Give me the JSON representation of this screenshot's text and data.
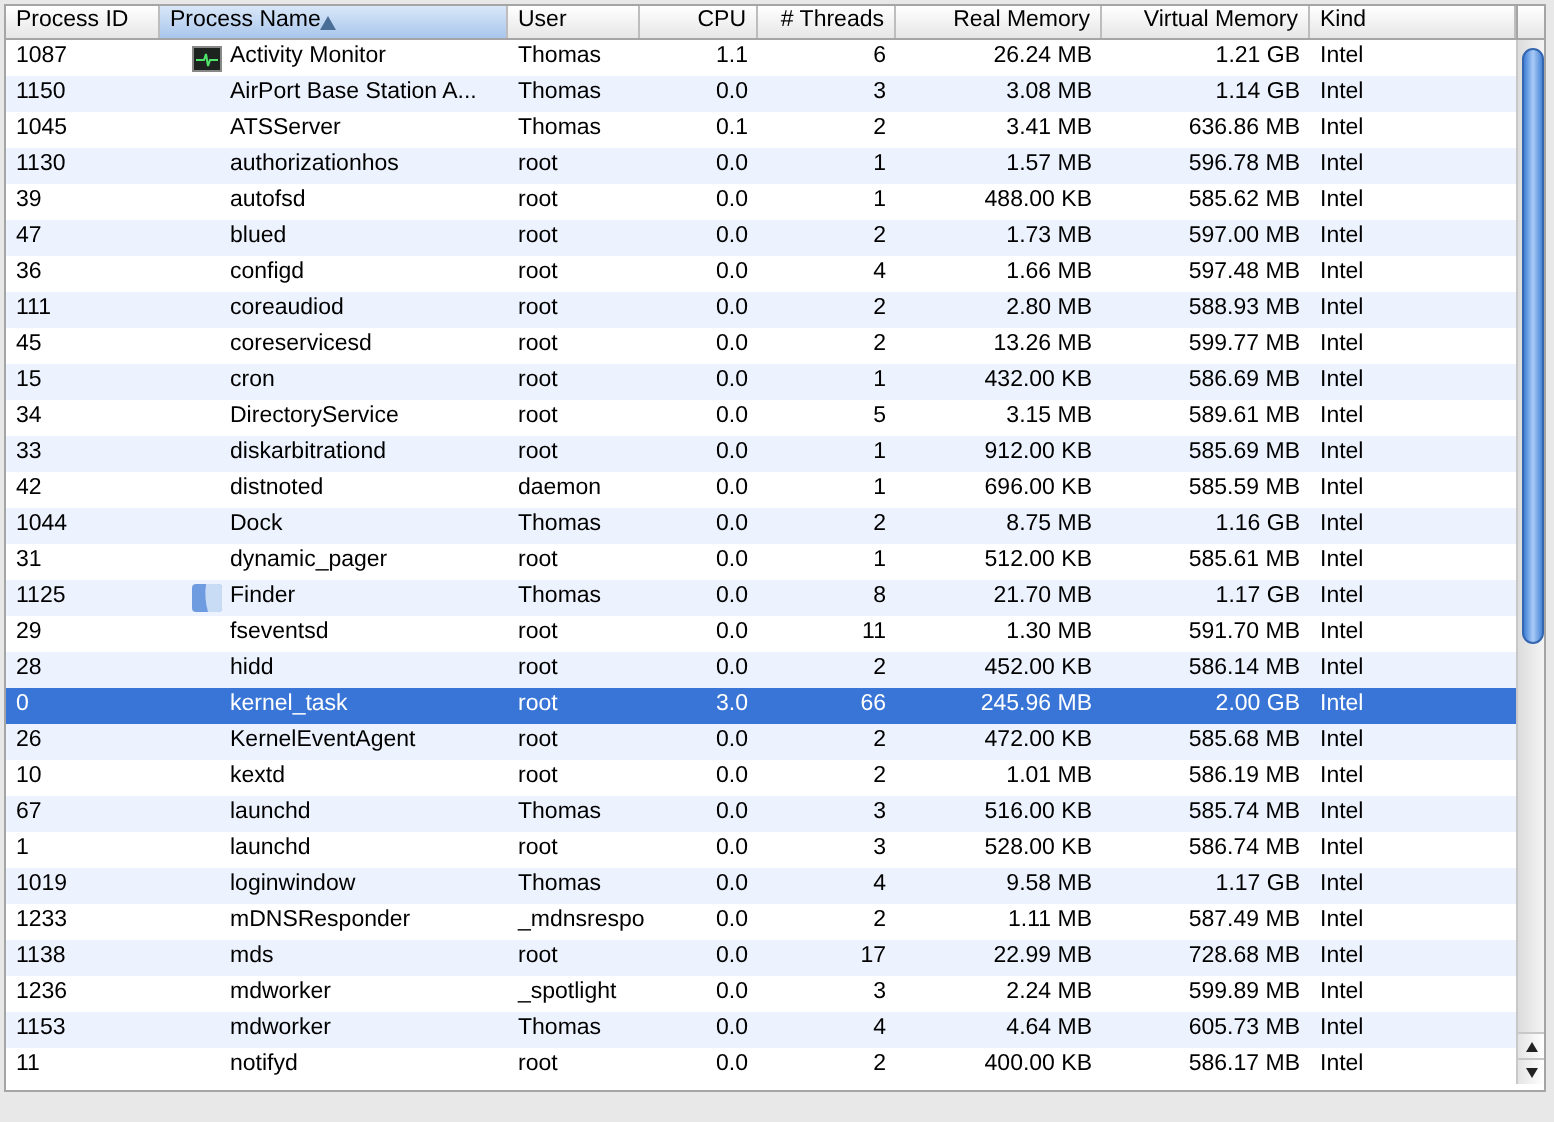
{
  "table": {
    "columns": [
      {
        "label": "Process ID",
        "selected": false
      },
      {
        "label": "Process Name",
        "selected": true
      },
      {
        "label": "User",
        "selected": false
      },
      {
        "label": "CPU",
        "selected": false
      },
      {
        "label": "# Threads",
        "selected": false
      },
      {
        "label": "Real Memory",
        "selected": false
      },
      {
        "label": "Virtual Memory",
        "selected": false
      },
      {
        "label": "Kind",
        "selected": false
      }
    ],
    "rows": [
      {
        "kind": "monitor",
        "selected": false,
        "cells": [
          "1087",
          "Activity Monitor",
          "Thomas",
          "1.1",
          "6",
          "26.24 MB",
          "1.21 GB",
          "Intel"
        ]
      },
      {
        "kind": "plain",
        "selected": false,
        "cells": [
          "1150",
          "AirPort Base Station A...",
          "Thomas",
          "0.0",
          "3",
          "3.08 MB",
          "1.14 GB",
          "Intel"
        ]
      },
      {
        "kind": "plain",
        "selected": false,
        "cells": [
          "1045",
          "ATSServer",
          "Thomas",
          "0.1",
          "2",
          "3.41 MB",
          "636.86 MB",
          "Intel"
        ]
      },
      {
        "kind": "plain",
        "selected": false,
        "cells": [
          "1130",
          "authorizationhos",
          "root",
          "0.0",
          "1",
          "1.57 MB",
          "596.78 MB",
          "Intel"
        ]
      },
      {
        "kind": "plain",
        "selected": false,
        "cells": [
          "39",
          "autofsd",
          "root",
          "0.0",
          "1",
          "488.00 KB",
          "585.62 MB",
          "Intel"
        ]
      },
      {
        "kind": "plain",
        "selected": false,
        "cells": [
          "47",
          "blued",
          "root",
          "0.0",
          "2",
          "1.73 MB",
          "597.00 MB",
          "Intel"
        ]
      },
      {
        "kind": "plain",
        "selected": false,
        "cells": [
          "36",
          "configd",
          "root",
          "0.0",
          "4",
          "1.66 MB",
          "597.48 MB",
          "Intel"
        ]
      },
      {
        "kind": "plain",
        "selected": false,
        "cells": [
          "111",
          "coreaudiod",
          "root",
          "0.0",
          "2",
          "2.80 MB",
          "588.93 MB",
          "Intel"
        ]
      },
      {
        "kind": "plain",
        "selected": false,
        "cells": [
          "45",
          "coreservicesd",
          "root",
          "0.0",
          "2",
          "13.26 MB",
          "599.77 MB",
          "Intel"
        ]
      },
      {
        "kind": "plain",
        "selected": false,
        "cells": [
          "15",
          "cron",
          "root",
          "0.0",
          "1",
          "432.00 KB",
          "586.69 MB",
          "Intel"
        ]
      },
      {
        "kind": "plain",
        "selected": false,
        "cells": [
          "34",
          "DirectoryService",
          "root",
          "0.0",
          "5",
          "3.15 MB",
          "589.61 MB",
          "Intel"
        ]
      },
      {
        "kind": "plain",
        "selected": false,
        "cells": [
          "33",
          "diskarbitrationd",
          "root",
          "0.0",
          "1",
          "912.00 KB",
          "585.69 MB",
          "Intel"
        ]
      },
      {
        "kind": "plain",
        "selected": false,
        "cells": [
          "42",
          "distnoted",
          "daemon",
          "0.0",
          "1",
          "696.00 KB",
          "585.59 MB",
          "Intel"
        ]
      },
      {
        "kind": "plain",
        "selected": false,
        "cells": [
          "1044",
          "Dock",
          "Thomas",
          "0.0",
          "2",
          "8.75 MB",
          "1.16 GB",
          "Intel"
        ]
      },
      {
        "kind": "plain",
        "selected": false,
        "cells": [
          "31",
          "dynamic_pager",
          "root",
          "0.0",
          "1",
          "512.00 KB",
          "585.61 MB",
          "Intel"
        ]
      },
      {
        "kind": "finder",
        "selected": false,
        "cells": [
          "1125",
          "Finder",
          "Thomas",
          "0.0",
          "8",
          "21.70 MB",
          "1.17 GB",
          "Intel"
        ]
      },
      {
        "kind": "plain",
        "selected": false,
        "cells": [
          "29",
          "fseventsd",
          "root",
          "0.0",
          "11",
          "1.30 MB",
          "591.70 MB",
          "Intel"
        ]
      },
      {
        "kind": "plain",
        "selected": false,
        "cells": [
          "28",
          "hidd",
          "root",
          "0.0",
          "2",
          "452.00 KB",
          "586.14 MB",
          "Intel"
        ]
      },
      {
        "kind": "plain",
        "selected": true,
        "cells": [
          "0",
          "kernel_task",
          "root",
          "3.0",
          "66",
          "245.96 MB",
          "2.00 GB",
          "Intel"
        ]
      },
      {
        "kind": "plain",
        "selected": false,
        "cells": [
          "26",
          "KernelEventAgent",
          "root",
          "0.0",
          "2",
          "472.00 KB",
          "585.68 MB",
          "Intel"
        ]
      },
      {
        "kind": "plain",
        "selected": false,
        "cells": [
          "10",
          "kextd",
          "root",
          "0.0",
          "2",
          "1.01 MB",
          "586.19 MB",
          "Intel"
        ]
      },
      {
        "kind": "plain",
        "selected": false,
        "cells": [
          "67",
          "launchd",
          "Thomas",
          "0.0",
          "3",
          "516.00 KB",
          "585.74 MB",
          "Intel"
        ]
      },
      {
        "kind": "plain",
        "selected": false,
        "cells": [
          "1",
          "launchd",
          "root",
          "0.0",
          "3",
          "528.00 KB",
          "586.74 MB",
          "Intel"
        ]
      },
      {
        "kind": "plain",
        "selected": false,
        "cells": [
          "1019",
          "loginwindow",
          "Thomas",
          "0.0",
          "4",
          "9.58 MB",
          "1.17 GB",
          "Intel"
        ]
      },
      {
        "kind": "plain",
        "selected": false,
        "cells": [
          "1233",
          "mDNSResponder",
          "_mdnsrespo",
          "0.0",
          "2",
          "1.11 MB",
          "587.49 MB",
          "Intel"
        ]
      },
      {
        "kind": "plain",
        "selected": false,
        "cells": [
          "1138",
          "mds",
          "root",
          "0.0",
          "17",
          "22.99 MB",
          "728.68 MB",
          "Intel"
        ]
      },
      {
        "kind": "plain",
        "selected": false,
        "cells": [
          "1236",
          "mdworker",
          "_spotlight",
          "0.0",
          "3",
          "2.24 MB",
          "599.89 MB",
          "Intel"
        ]
      },
      {
        "kind": "plain",
        "selected": false,
        "cells": [
          "1153",
          "mdworker",
          "Thomas",
          "0.0",
          "4",
          "4.64 MB",
          "605.73 MB",
          "Intel"
        ]
      },
      {
        "kind": "plain",
        "selected": false,
        "cells": [
          "11",
          "notifyd",
          "root",
          "0.0",
          "2",
          "400.00 KB",
          "586.17 MB",
          "Intel"
        ]
      }
    ]
  }
}
